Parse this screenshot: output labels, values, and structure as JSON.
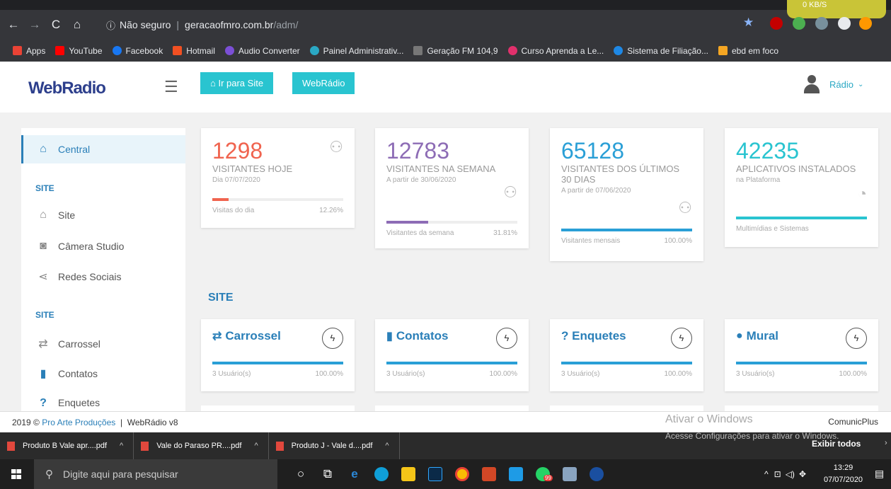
{
  "browser": {
    "address": {
      "insecure_label": "Não seguro",
      "host": "geracaofmro.com.br",
      "path": "/adm/"
    },
    "net_speed": "0 KB/S",
    "bookmarks": [
      {
        "label": "Apps",
        "color": "#ea4335"
      },
      {
        "label": "YouTube",
        "color": "#ff0000"
      },
      {
        "label": "Facebook",
        "color": "#1877f2"
      },
      {
        "label": "Hotmail",
        "color": "#f25022"
      },
      {
        "label": "Audio Converter",
        "color": "#7b4fd6"
      },
      {
        "label": "Painel Administrativ...",
        "color": "#2aa8c4"
      },
      {
        "label": "Geração FM 104,9",
        "color": "#777777"
      },
      {
        "label": "Curso Aprenda a Le...",
        "color": "#e1306c"
      },
      {
        "label": "Sistema de Filiação...",
        "color": "#1e88e5"
      },
      {
        "label": "ebd em foco",
        "color": "#f5a623"
      }
    ]
  },
  "header": {
    "logo": "WebRadio",
    "btn_site": "Ir para Site",
    "btn_webradio": "WebRádio",
    "user": "Rádio"
  },
  "sidebar": {
    "central": "Central",
    "head_site1": "SITE",
    "site": "Site",
    "camera": "Câmera Studio",
    "redes": "Redes Sociais",
    "head_site2": "SITE",
    "carrossel": "Carrossel",
    "contatos": "Contatos",
    "enquetes": "Enquetes"
  },
  "stats": [
    {
      "value": "1298",
      "label": "VISITANTES HOJE",
      "sub": "Dia 07/07/2020",
      "bar_label": "Visitas do dia",
      "pct": "12.26%",
      "fraction": 0.1226,
      "color": "#f0644f"
    },
    {
      "value": "12783",
      "label": "VISITANTES NA SEMANA",
      "sub": "A partir de 30/06/2020",
      "bar_label": "Visitantes da semana",
      "pct": "31.81%",
      "fraction": 0.3181,
      "color": "#8d6cb5"
    },
    {
      "value": "65128",
      "label": "VISITANTES DOS ÚLTIMOS 30 DIAS",
      "sub": "A partir de 07/06/2020",
      "bar_label": "Visitantes mensais",
      "pct": "100.00%",
      "fraction": 1.0,
      "color": "#2a9fd6"
    },
    {
      "value": "42235",
      "label": "APLICATIVOS INSTALADOS",
      "sub": "na Plataforma",
      "bar_label": "Multimídias e Sistemas",
      "pct": "",
      "fraction": 1.0,
      "color": "#29c4d0"
    }
  ],
  "section_title": "SITE",
  "modules": [
    {
      "title": "Carrossel",
      "icon": "⇄",
      "users": "3 Usuário(s)",
      "pct": "100.00%"
    },
    {
      "title": "Contatos",
      "icon": "▮",
      "users": "3 Usuário(s)",
      "pct": "100.00%"
    },
    {
      "title": "? Enquetes",
      "icon": "",
      "users": "3 Usuário(s)",
      "pct": "100.00%"
    },
    {
      "title": "Mural",
      "icon": "●",
      "users": "3 Usuário(s)",
      "pct": "100.00%"
    }
  ],
  "footer": {
    "year": "2019 ©",
    "company": "Pro Arte Produções",
    "sep": "|",
    "version": "WebRádio v8",
    "right": "ComunicPlus"
  },
  "windows_notice": {
    "title": "Ativar o Windows",
    "text": "Acesse Configurações para ativar o Windows."
  },
  "downloads": [
    {
      "name": "Produto B Vale apr....pdf"
    },
    {
      "name": "Vale do Paraso PR....pdf"
    },
    {
      "name": "Produto J - Vale d....pdf"
    }
  ],
  "downloads_show_all": "Exibir todos",
  "taskbar": {
    "search_placeholder": "Digite aqui para pesquisar",
    "time": "13:29",
    "date": "07/07/2020",
    "badge": "99"
  }
}
